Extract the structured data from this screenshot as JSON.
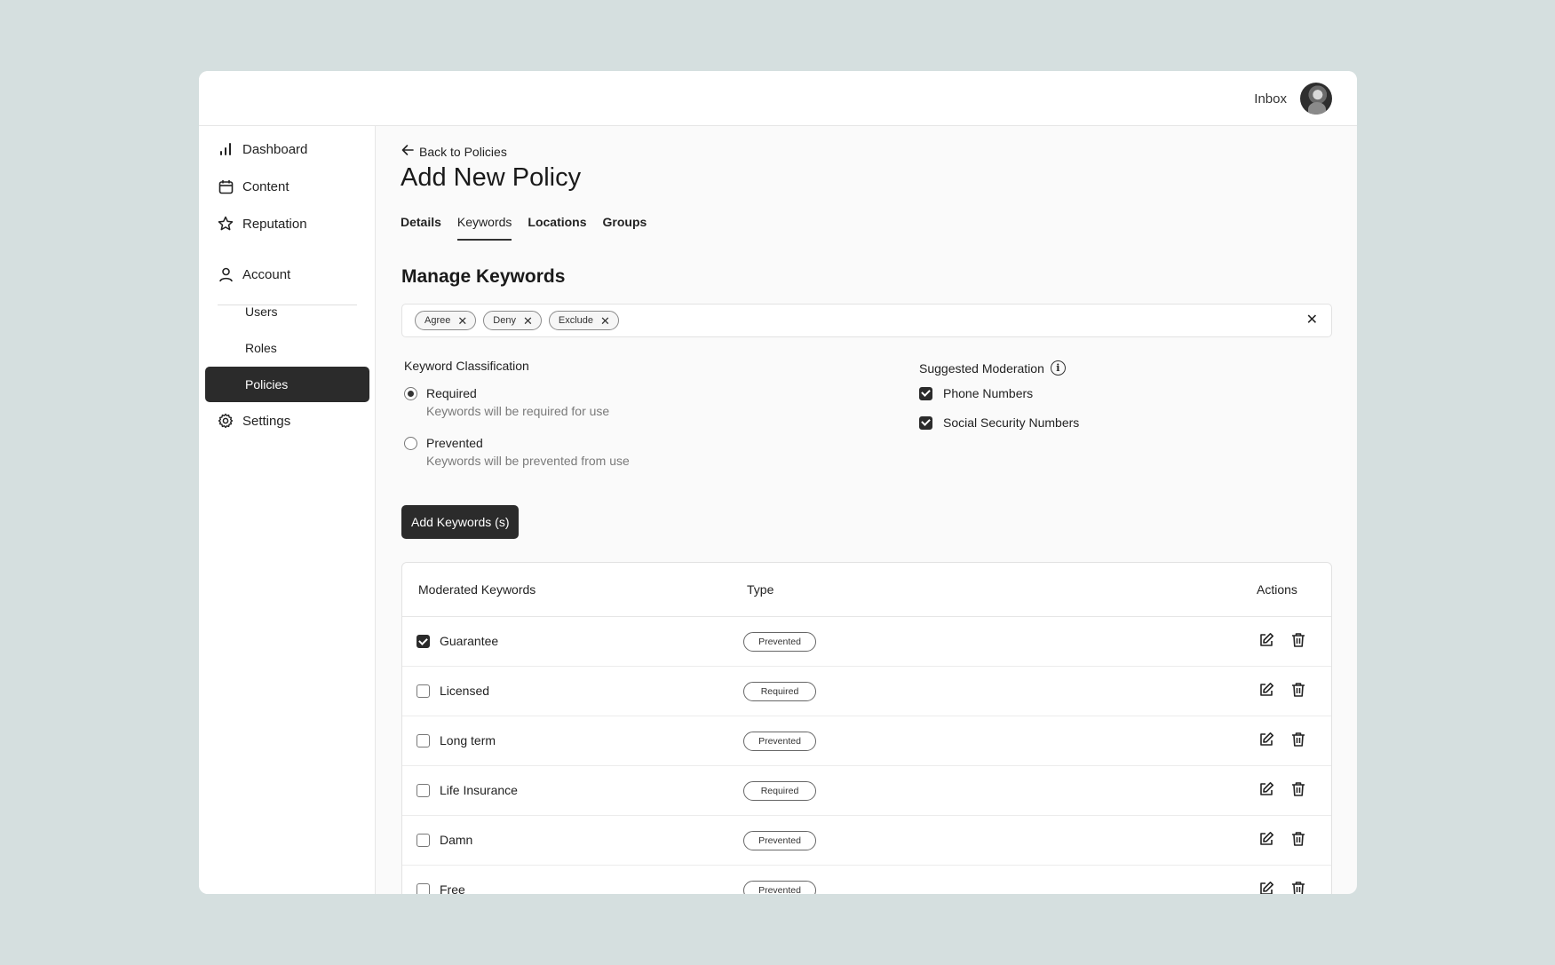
{
  "header": {
    "inbox_label": "Inbox"
  },
  "sidebar": {
    "items": [
      {
        "label": "Dashboard",
        "icon": "bar-chart-icon"
      },
      {
        "label": "Content",
        "icon": "calendar-icon"
      },
      {
        "label": "Reputation",
        "icon": "star-icon"
      },
      {
        "label": "Account",
        "icon": "user-icon"
      },
      {
        "label": "Users"
      },
      {
        "label": "Roles"
      },
      {
        "label": "Policies",
        "active": true
      },
      {
        "label": "Settings",
        "icon": "gear-icon"
      }
    ]
  },
  "page": {
    "back_label": "Back to Policies",
    "title": "Add New Policy",
    "tabs": [
      "Details",
      "Keywords",
      "Locations",
      "Groups"
    ],
    "active_tab": "Keywords",
    "section_title": "Manage Keywords"
  },
  "tags": [
    "Agree",
    "Deny",
    "Exclude"
  ],
  "classification": {
    "label": "Keyword Classification",
    "options": [
      {
        "title": "Required",
        "desc": "Keywords will be required for use",
        "selected": true
      },
      {
        "title": "Prevented",
        "desc": "Keywords will be prevented from use",
        "selected": false
      }
    ]
  },
  "moderation": {
    "label": "Suggested Moderation",
    "options": [
      {
        "label": "Phone Numbers",
        "checked": true
      },
      {
        "label": "Social Security Numbers",
        "checked": true
      }
    ]
  },
  "add_button_label": "Add Keywords (s)",
  "table": {
    "headers": {
      "keyword": "Moderated Keywords",
      "type": "Type",
      "actions": "Actions"
    },
    "rows": [
      {
        "keyword": "Guarantee",
        "type": "Prevented",
        "checked": true
      },
      {
        "keyword": "Licensed",
        "type": "Required",
        "checked": false
      },
      {
        "keyword": "Long term",
        "type": "Prevented",
        "checked": false
      },
      {
        "keyword": "Life Insurance",
        "type": "Required",
        "checked": false
      },
      {
        "keyword": "Damn",
        "type": "Prevented",
        "checked": false
      },
      {
        "keyword": "Free",
        "type": "Prevented",
        "checked": false
      }
    ]
  },
  "colors": {
    "background": "#d5dfdf",
    "active_nav": "#2b2b2b",
    "primary_button": "#2b2b2b"
  }
}
